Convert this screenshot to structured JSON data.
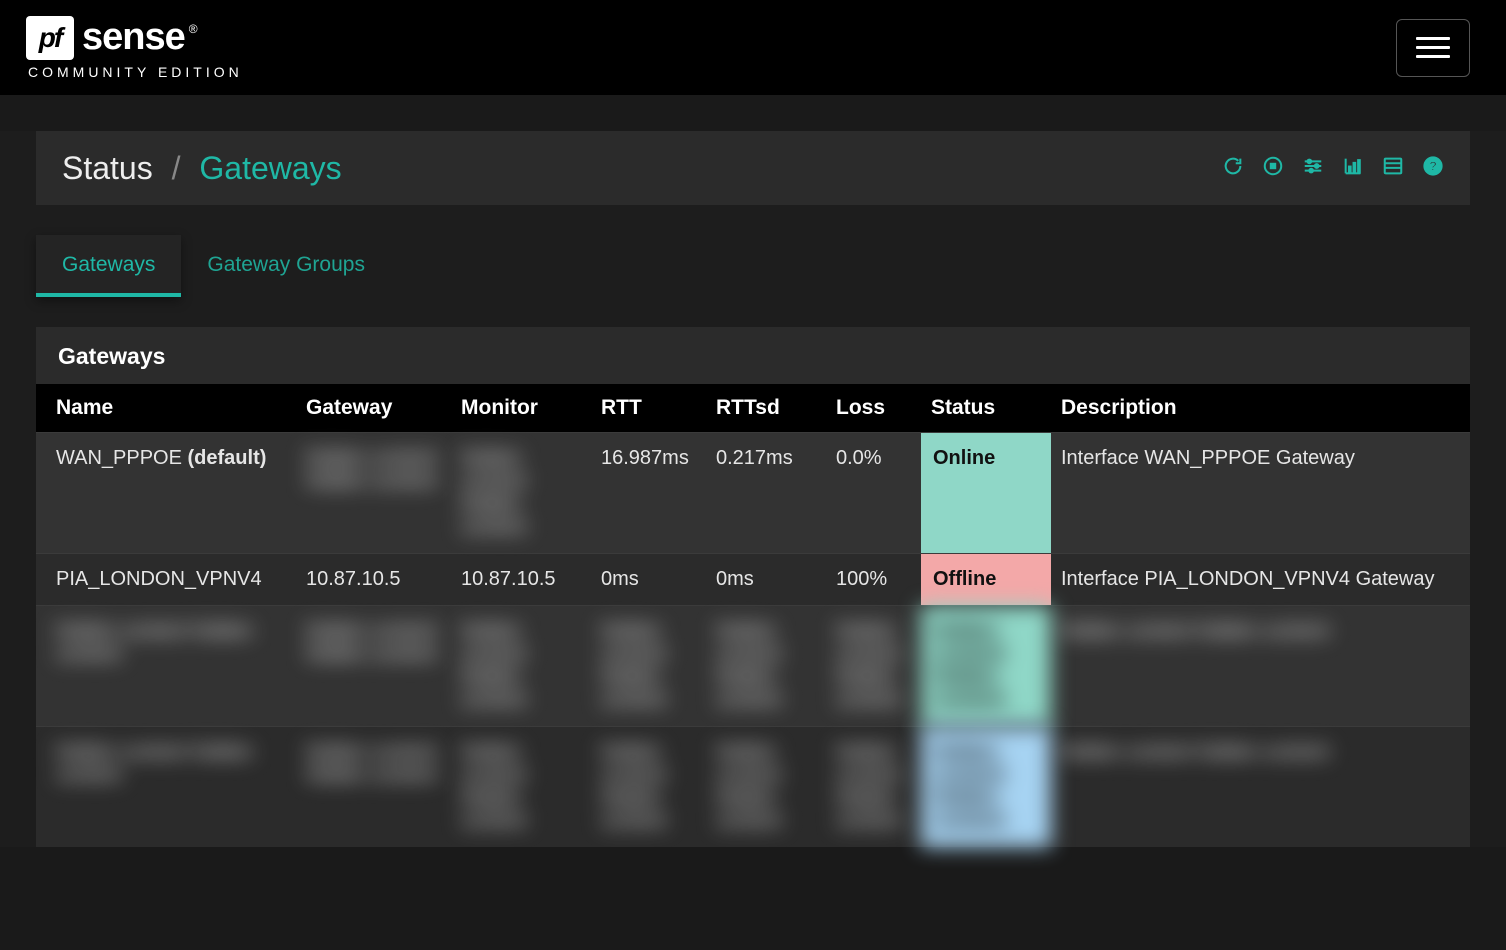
{
  "logo": {
    "pf": "pf",
    "sense": "sense",
    "subtitle": "COMMUNITY EDITION"
  },
  "breadcrumb": {
    "section": "Status",
    "page": "Gateways"
  },
  "tabs": [
    {
      "label": "Gateways",
      "active": true
    },
    {
      "label": "Gateway Groups",
      "active": false
    }
  ],
  "panel": {
    "title": "Gateways"
  },
  "columns": {
    "name": "Name",
    "gateway": "Gateway",
    "monitor": "Monitor",
    "rtt": "RTT",
    "rttsd": "RTTsd",
    "loss": "Loss",
    "status": "Status",
    "description": "Description"
  },
  "rows": [
    {
      "name": "WAN_PPPOE",
      "default_suffix": "(default)",
      "gateway": "",
      "gateway_blur": true,
      "monitor": "",
      "monitor_blur": true,
      "rtt": "16.987ms",
      "rttsd": "0.217ms",
      "loss": "0.0%",
      "status": "Online",
      "status_class": "online",
      "description": "Interface WAN_PPPOE Gateway",
      "row_blur": false
    },
    {
      "name": "PIA_LONDON_VPNV4",
      "default_suffix": "",
      "gateway": "10.87.10.5",
      "gateway_blur": false,
      "monitor": "10.87.10.5",
      "monitor_blur": false,
      "rtt": "0ms",
      "rttsd": "0ms",
      "loss": "100%",
      "status": "Offline",
      "status_class": "offline",
      "description": "Interface PIA_LONDON_VPNV4 Gateway",
      "row_blur": false
    },
    {
      "name": "",
      "default_suffix": "",
      "gateway": "",
      "gateway_blur": false,
      "monitor": "",
      "monitor_blur": false,
      "rtt": "",
      "rttsd": "",
      "loss": "",
      "status": "",
      "status_class": "online",
      "description": "",
      "row_blur": true
    },
    {
      "name": "",
      "default_suffix": "",
      "gateway": "",
      "gateway_blur": false,
      "monitor": "",
      "monitor_blur": false,
      "rtt": "",
      "rttsd": "",
      "loss": "",
      "status": "",
      "status_class": "pending",
      "description": "",
      "row_blur": true
    }
  ],
  "blur_placeholder": "hidden content hidden content"
}
